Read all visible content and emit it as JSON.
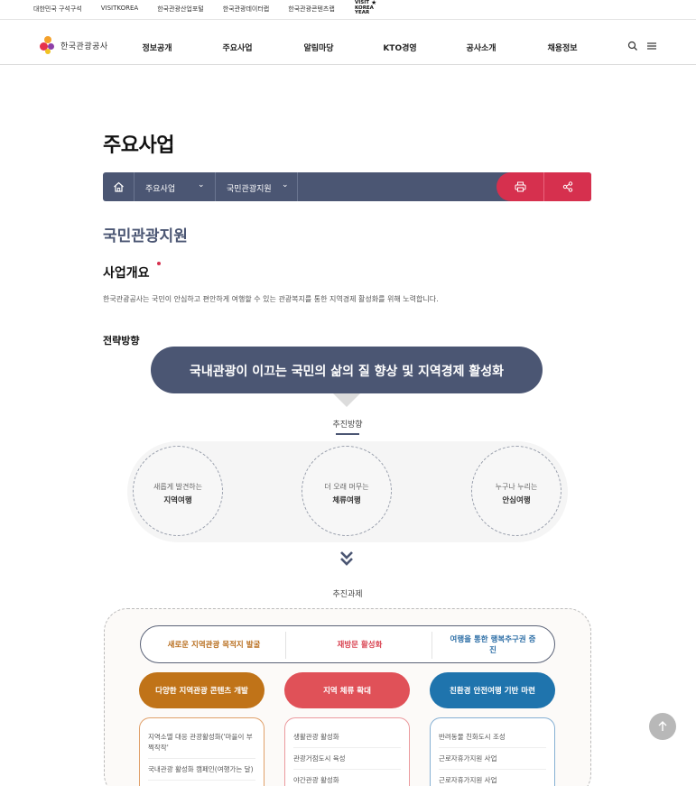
{
  "topbar": {
    "links": [
      "대한민국 구석구석",
      "VISITKOREA",
      "한국관광산업포털",
      "한국관광데이터랩",
      "한국관광콘텐츠랩"
    ],
    "campaign_logo_text": "VISIT KOREA YEAR"
  },
  "header": {
    "logo_text": "한국관광공사",
    "menu": [
      "정보공개",
      "주요사업",
      "알림마당",
      "KTO경영",
      "공사소개",
      "채용정보"
    ],
    "search_icon": "search-icon",
    "menu_icon": "hamburger-icon"
  },
  "page": {
    "title": "주요사업",
    "breadcrumb": {
      "home_icon": "home-icon",
      "level1": "주요사업",
      "level2": "국민관광지원",
      "print_icon": "print-icon",
      "share_icon": "share-icon"
    },
    "subtitle": "국민관광지원",
    "overview_heading": "사업개요",
    "overview_text": "한국관광공사는 국민이 안심하고 편안하게 여행할 수 있는 관광복지를 통한 지역경제 활성화를 위해 노력합니다.",
    "strategy_heading": "전략방향"
  },
  "strategy": {
    "vision": "국내관광이 이끄는 국민의 삶의 질 향상 및 지역경제 활성화",
    "directions_label": "추진방향",
    "directions": [
      {
        "line1": "새롭게 발견하는",
        "line2": "지역여행"
      },
      {
        "line1": "더 오래 머무는",
        "line2": "체류여행"
      },
      {
        "line1": "누구나 누리는",
        "line2": "안심여행"
      }
    ],
    "tasks_label": "추진과제",
    "goals": [
      {
        "text": "새로운 지역관광 목적지 발굴",
        "color": "#b86e1e"
      },
      {
        "text": "재방문 활성화",
        "color": "#d94452"
      },
      {
        "text": "여행을 통한 행복추구권 증진",
        "color": "#2c6ea6"
      }
    ],
    "tasks": [
      {
        "title": "다양한 지역관광 콘텐츠 개발",
        "color": "#c07318",
        "items": [
          "지역소멸 대응 관광활성화('마을이 부쩍작작'",
          "국내관광 활성화 캠페인(여행가는 달)"
        ]
      },
      {
        "title": "지역 체류 확대",
        "color": "#e05158",
        "items": [
          "생활관광 활성화",
          "관광거점도시 육성",
          "야간관광 활성화"
        ]
      },
      {
        "title": "친환경 안전여행 기반 마련",
        "color": "#1f74ad",
        "items": [
          "반려동물 친화도시 조성",
          "근로자휴가지원 사업",
          "근로자휴가지원 사업"
        ]
      }
    ]
  },
  "scroll_top_icon": "arrow-up-icon"
}
